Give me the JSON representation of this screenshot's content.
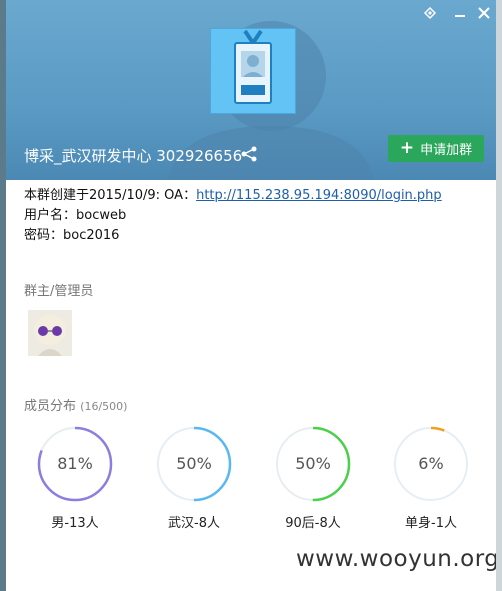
{
  "window": {
    "title_group": "博采_武汉研发中心 302926656",
    "join_button_label": "申请加群",
    "controls": [
      "pin",
      "minimize",
      "close"
    ]
  },
  "info": {
    "line1_prefix": "本群创建于2015/10/9:  OA：",
    "line1_link": "http://115.238.95.194:8090/login.php",
    "line2": "用户名：bocweb",
    "line3": "密码：boc2016"
  },
  "admins": {
    "label": "群主/管理员"
  },
  "members": {
    "label": "成员分布",
    "count": "(16/500)",
    "stats": [
      {
        "pct_text": "81%",
        "value": 0.81,
        "label": "男-13人",
        "color": "#8a7fe0"
      },
      {
        "pct_text": "50%",
        "value": 0.5,
        "label": "武汉-8人",
        "color": "#5ab8f0"
      },
      {
        "pct_text": "50%",
        "value": 0.5,
        "label": "90后-8人",
        "color": "#4ccf4c"
      },
      {
        "pct_text": "6%",
        "value": 0.06,
        "label": "单身-1人",
        "color": "#f0a020"
      }
    ]
  },
  "watermark": "www.wooyun.org"
}
